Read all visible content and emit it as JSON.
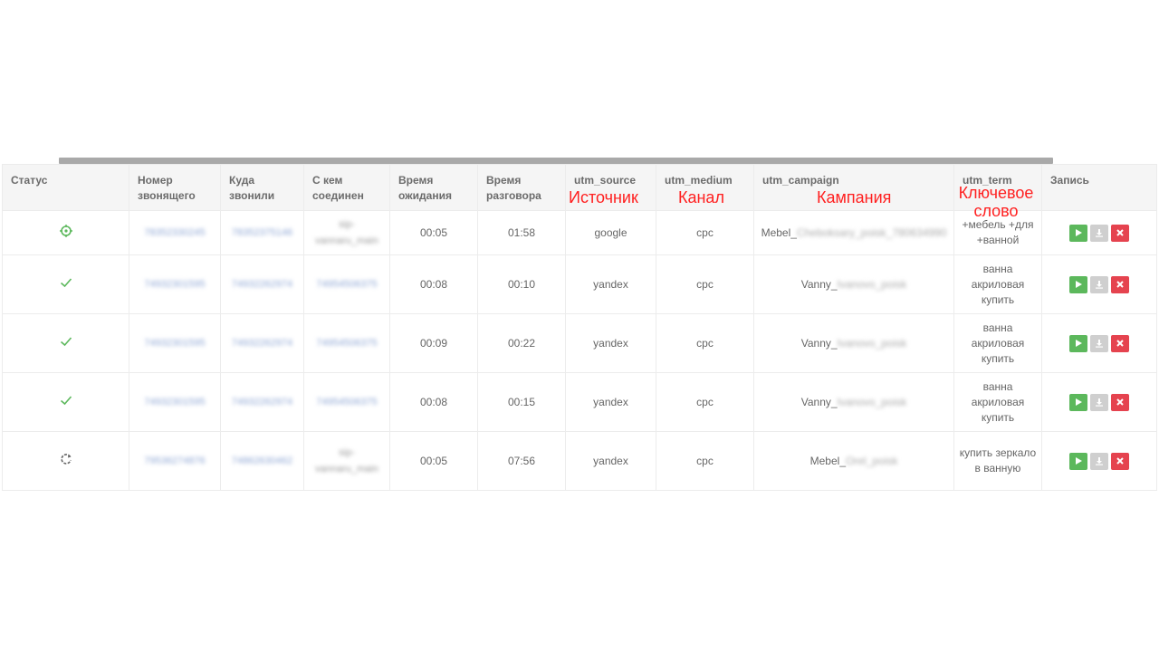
{
  "columns": {
    "status": "Статус",
    "caller": "Номер звонящего",
    "called": "Куда звонили",
    "connected": "С кем соединен",
    "wait": "Время ожидания",
    "talk": "Время разговора",
    "utm_source": "utm_source",
    "utm_medium": "utm_medium",
    "utm_campaign": "utm_campaign",
    "utm_term": "utm_term",
    "record": "Запись"
  },
  "annotations": {
    "source": "Источник",
    "medium": "Канал",
    "campaign": "Кампания",
    "term": "Ключевое слово"
  },
  "rows": [
    {
      "status_icon": "target-icon",
      "caller": "78352330245",
      "called": "78352375146",
      "connected": "sip-vannaru_main",
      "wait": "00:05",
      "talk": "01:58",
      "source": "google",
      "medium": "cpc",
      "campaign_prefix": "Mebel_",
      "campaign_rest": "Cheboksary_poisk_780634990",
      "term": "+мебель +для +ванной"
    },
    {
      "status_icon": "check-icon",
      "caller": "74932301595",
      "called": "74932262974",
      "connected": "74954506375",
      "wait": "00:08",
      "talk": "00:10",
      "source": "yandex",
      "medium": "cpc",
      "campaign_prefix": "Vanny_",
      "campaign_rest": "Ivanovo_poisk",
      "term": "ванна акриловая купить"
    },
    {
      "status_icon": "check-icon",
      "caller": "74932301595",
      "called": "74932262974",
      "connected": "74954506375",
      "wait": "00:09",
      "talk": "00:22",
      "source": "yandex",
      "medium": "cpc",
      "campaign_prefix": "Vanny_",
      "campaign_rest": "Ivanovo_poisk",
      "term": "ванна акриловая купить"
    },
    {
      "status_icon": "check-icon",
      "caller": "74932301595",
      "called": "74932262974",
      "connected": "74954506375",
      "wait": "00:08",
      "talk": "00:15",
      "source": "yandex",
      "medium": "cpc",
      "campaign_prefix": "Vanny_",
      "campaign_rest": "Ivanovo_poisk",
      "term": "ванна акриловая купить"
    },
    {
      "status_icon": "refresh-icon",
      "caller": "79536274876",
      "called": "74862630462",
      "connected": "sip-vannaru_main",
      "wait": "00:05",
      "talk": "07:56",
      "source": "yandex",
      "medium": "cpc",
      "campaign_prefix": "Mebel_",
      "campaign_rest": "Orel_poisk",
      "term": "купить зеркало в ванную"
    }
  ],
  "colors": {
    "play": "#5cb85c",
    "download": "#cfcfcf",
    "delete": "#e5434f",
    "annotation": "#ff2020",
    "status_green": "#5cb85c"
  }
}
